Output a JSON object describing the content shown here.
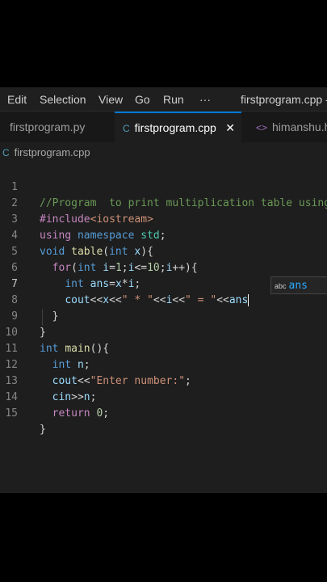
{
  "menu": [
    "Edit",
    "Selection",
    "View",
    "Go",
    "Run",
    "···"
  ],
  "window_title": "firstprogram.cpp - .",
  "tabs": [
    {
      "label": "firstprogram.py",
      "icon": "python-file-icon"
    },
    {
      "label": "firstprogram.cpp",
      "icon": "cpp-file-icon",
      "active": true,
      "close": "✕"
    },
    {
      "label": "himanshu.h",
      "icon": "code-file-icon"
    }
  ],
  "breadcrumb": {
    "file": "firstprogram.cpp"
  },
  "line_numbers": [
    "1",
    "2",
    "3",
    "4",
    "5",
    "6",
    "7",
    "8",
    "9",
    "10",
    "11",
    "12",
    "13",
    "14",
    "15"
  ],
  "suggestion": {
    "kind": "abc",
    "label": "ans"
  },
  "colors": {
    "keyword": "#569cd6",
    "control": "#c586c0",
    "string": "#ce9178",
    "function": "#dcdcaa",
    "variable": "#9cdcfe",
    "comment": "#6a9955",
    "accent": "#0078d4"
  },
  "code": {
    "l1": {
      "comment": "//Program  to print multiplication table using"
    },
    "l2": {
      "directive": "#include",
      "header": "<iostream>"
    },
    "l3": {
      "using": "using",
      "namespace": "namespace",
      "std": "std",
      "semi": ";"
    },
    "l4": {
      "void": "void",
      "name": "table",
      "paren_open": "(",
      "int": "int",
      "param": "x",
      "rest": "){"
    },
    "l5": {
      "for": "for",
      "p1": "(",
      "int": "int",
      "i": "i",
      "eq": "=",
      "one": "1",
      "semi1": ";",
      "i2": "i",
      "lte": "<=",
      "ten": "10",
      "semi2": ";",
      "i3": "i",
      "inc": "++",
      "rest": "){"
    },
    "l6": {
      "int": "int",
      "ans": "ans",
      "eq": "=",
      "x": "x",
      "mul": "*",
      "i": "i",
      "semi": ";"
    },
    "l7": {
      "cout": "cout",
      "op1": "<<",
      "x": "x",
      "op2": "<<",
      "s1": "\" * \"",
      "op3": "<<",
      "i": "i",
      "op4": "<<",
      "s2": "\" = \"",
      "op5": "<<",
      "ans": "ans"
    },
    "l8": {
      "brace": "}"
    },
    "l9": {
      "brace": "}"
    },
    "l10": {
      "int": "int",
      "main": "main",
      "rest": "(){"
    },
    "l11": {
      "int": "int",
      "n": "n",
      "semi": ";"
    },
    "l12": {
      "cout": "cout",
      "op": "<<",
      "str": "\"Enter number:\"",
      "semi": ";"
    },
    "l13": {
      "cin": "cin",
      "op": ">>",
      "n": "n",
      "semi": ";"
    },
    "l14": {
      "ret": "return",
      "zero": "0",
      "semi": ";"
    },
    "l15": {
      "brace": "}"
    }
  }
}
